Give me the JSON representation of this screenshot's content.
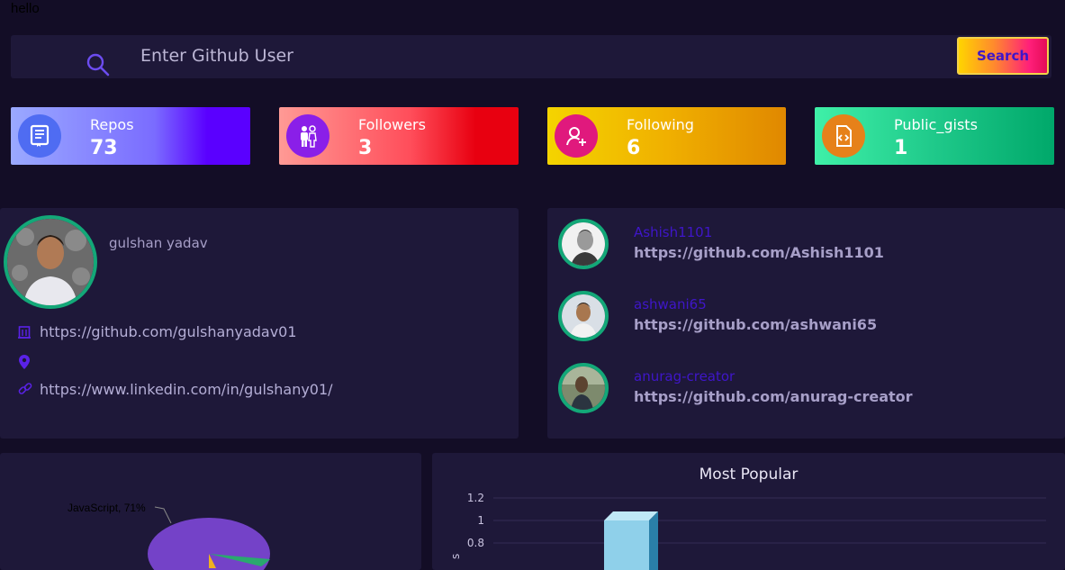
{
  "page": {
    "hello_text": "hello"
  },
  "search": {
    "placeholder": "Enter Github User",
    "button_label": "Search"
  },
  "stats": [
    {
      "label": "Repos",
      "value": "73",
      "icon": "book-icon"
    },
    {
      "label": "Followers",
      "value": "3",
      "icon": "people-icon"
    },
    {
      "label": "Following",
      "value": "6",
      "icon": "user-plus-icon"
    },
    {
      "label": "Public_gists",
      "value": "1",
      "icon": "code-file-icon"
    }
  ],
  "profile": {
    "name": "gulshan yadav",
    "github_url": "https://github.com/gulshanyadav01",
    "location": "",
    "linkedin_url": "https://www.linkedin.com/in/gulshany01/"
  },
  "followers": [
    {
      "name": "Ashish1101",
      "url": "https://github.com/Ashish1101"
    },
    {
      "name": "ashwani65",
      "url": "https://github.com/ashwani65"
    },
    {
      "name": "anurag-creator",
      "url": "https://github.com/anurag-creator"
    }
  ],
  "pie_chart": {
    "label": "JavaScript, 71%"
  },
  "chart_data": [
    {
      "type": "pie",
      "slices": [
        {
          "name": "JavaScript",
          "percent": 71
        }
      ]
    },
    {
      "type": "bar",
      "title": "Most Popular",
      "yticks": [
        "1.2",
        "1",
        "0.8"
      ],
      "ylim": [
        0,
        1.2
      ],
      "ylabel_fragment": "s",
      "values": [
        1
      ]
    }
  ],
  "colors": {
    "background": "#130d26",
    "panel": "#1e1839",
    "accent_purple": "#3f16c9",
    "ring_green": "#13a878"
  }
}
